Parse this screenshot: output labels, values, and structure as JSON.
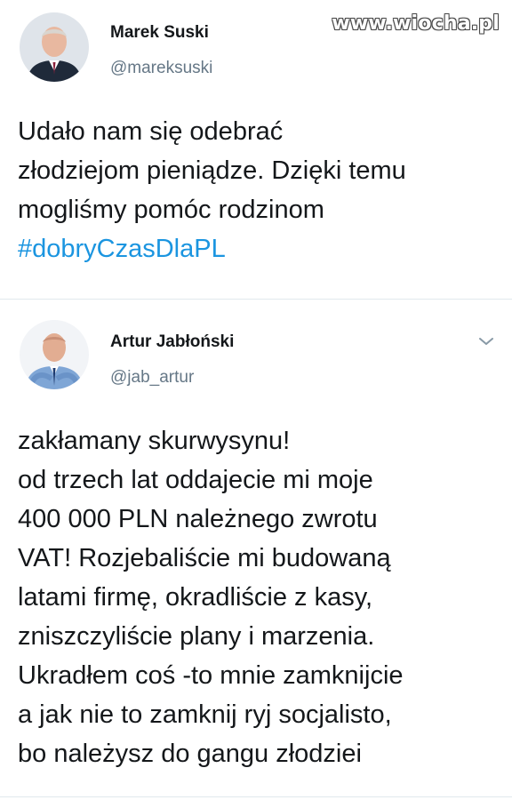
{
  "watermark": "www.wiocha.pl",
  "tweets": [
    {
      "display_name": "Marek Suski",
      "handle": "@mareksuski",
      "avatar_icon": "person-photo-avatar",
      "body_lines": [
        "Udało nam się odebrać",
        "złodziejom pieniądze. Dzięki temu",
        "mogliśmy pomóc rodzinom"
      ],
      "hashtag": "#dobryCzasDlaPL"
    },
    {
      "display_name": "Artur Jabłoński",
      "handle": "@jab_artur",
      "avatar_icon": "person-photo-avatar",
      "menu_icon": "chevron-down-icon",
      "body_lines": [
        "zakłamany skurwysynu!",
        "od trzech lat oddajecie mi moje",
        "400 000 PLN należnego zwrotu",
        "VAT! Rozjebaliście mi budowaną",
        "latami firmę, okradliście z kasy,",
        "zniszczyliście plany i marzenia.",
        "Ukradłem coś -to mnie zamknijcie",
        "a jak nie to zamknij ryj socjalisto,",
        "bo należysz do gangu złodziei"
      ]
    }
  ],
  "colors": {
    "text": "#14171a",
    "handle": "#657786",
    "hashtag": "#1b95e0",
    "divider": "#e1e8ed"
  }
}
